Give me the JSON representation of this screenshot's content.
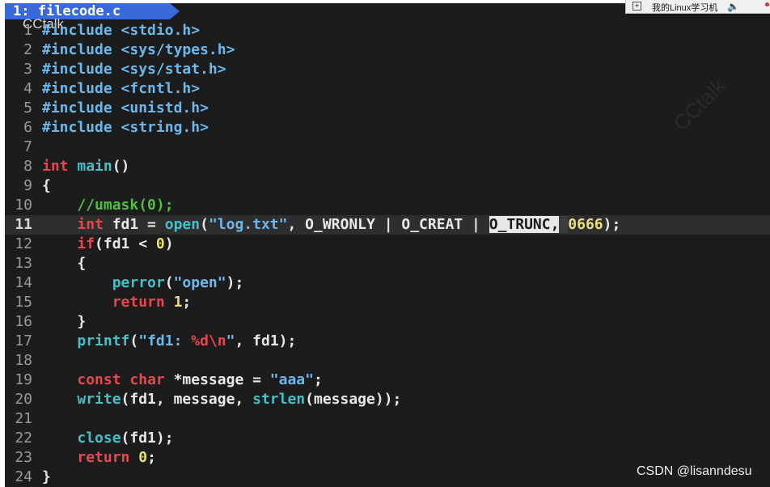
{
  "editor": {
    "tab_label": "1: filecode.c",
    "current_line": 11,
    "lines": [
      {
        "n": "1",
        "tokens": [
          {
            "t": "#include ",
            "c": "pre"
          },
          {
            "t": "<stdio.h>",
            "c": "pre"
          }
        ]
      },
      {
        "n": "2",
        "tokens": [
          {
            "t": "#include ",
            "c": "pre"
          },
          {
            "t": "<sys/types.h>",
            "c": "pre"
          }
        ]
      },
      {
        "n": "3",
        "tokens": [
          {
            "t": "#include ",
            "c": "pre"
          },
          {
            "t": "<sys/stat.h>",
            "c": "pre"
          }
        ]
      },
      {
        "n": "4",
        "tokens": [
          {
            "t": "#include ",
            "c": "pre"
          },
          {
            "t": "<fcntl.h>",
            "c": "pre"
          }
        ]
      },
      {
        "n": "5",
        "tokens": [
          {
            "t": "#include ",
            "c": "pre"
          },
          {
            "t": "<unistd.h>",
            "c": "pre"
          }
        ]
      },
      {
        "n": "6",
        "tokens": [
          {
            "t": "#include ",
            "c": "pre"
          },
          {
            "t": "<string.h>",
            "c": "pre"
          }
        ]
      },
      {
        "n": "7",
        "tokens": []
      },
      {
        "n": "8",
        "tokens": [
          {
            "t": "int",
            "c": "kw"
          },
          {
            "t": " ",
            "c": "plain"
          },
          {
            "t": "main",
            "c": "fn"
          },
          {
            "t": "()",
            "c": "plain"
          }
        ]
      },
      {
        "n": "9",
        "tokens": [
          {
            "t": "{",
            "c": "plain"
          }
        ]
      },
      {
        "n": "10",
        "tokens": [
          {
            "t": "    ",
            "c": "plain"
          },
          {
            "t": "//umask(0);",
            "c": "cmt"
          }
        ]
      },
      {
        "n": "11",
        "tokens": [
          {
            "t": "    ",
            "c": "plain"
          },
          {
            "t": "int",
            "c": "kw"
          },
          {
            "t": " fd1 = ",
            "c": "plain"
          },
          {
            "t": "open",
            "c": "fn"
          },
          {
            "t": "(",
            "c": "plain"
          },
          {
            "t": "\"log.txt\"",
            "c": "str"
          },
          {
            "t": ", O_WRONLY | O_CREAT | ",
            "c": "plain"
          },
          {
            "t": "O_TRUNC,",
            "c": "sel"
          },
          {
            "t": " ",
            "c": "cursor"
          },
          {
            "t": "0666",
            "c": "num"
          },
          {
            "t": ");",
            "c": "plain"
          }
        ]
      },
      {
        "n": "12",
        "tokens": [
          {
            "t": "    ",
            "c": "plain"
          },
          {
            "t": "if",
            "c": "kw"
          },
          {
            "t": "(fd1 < ",
            "c": "plain"
          },
          {
            "t": "0",
            "c": "num"
          },
          {
            "t": ")",
            "c": "plain"
          }
        ]
      },
      {
        "n": "13",
        "tokens": [
          {
            "t": "    {",
            "c": "plain"
          }
        ]
      },
      {
        "n": "14",
        "tokens": [
          {
            "t": "        ",
            "c": "plain"
          },
          {
            "t": "perror",
            "c": "fn"
          },
          {
            "t": "(",
            "c": "plain"
          },
          {
            "t": "\"open\"",
            "c": "str"
          },
          {
            "t": ");",
            "c": "plain"
          }
        ]
      },
      {
        "n": "15",
        "tokens": [
          {
            "t": "        ",
            "c": "plain"
          },
          {
            "t": "return",
            "c": "kw"
          },
          {
            "t": " ",
            "c": "plain"
          },
          {
            "t": "1",
            "c": "num"
          },
          {
            "t": ";",
            "c": "plain"
          }
        ]
      },
      {
        "n": "16",
        "tokens": [
          {
            "t": "    }",
            "c": "plain"
          }
        ]
      },
      {
        "n": "17",
        "tokens": [
          {
            "t": "    ",
            "c": "plain"
          },
          {
            "t": "printf",
            "c": "fn"
          },
          {
            "t": "(",
            "c": "plain"
          },
          {
            "t": "\"fd1: ",
            "c": "str"
          },
          {
            "t": "%d",
            "c": "kw"
          },
          {
            "t": "\\n",
            "c": "kw"
          },
          {
            "t": "\"",
            "c": "str"
          },
          {
            "t": ", fd1);",
            "c": "plain"
          }
        ]
      },
      {
        "n": "18",
        "tokens": []
      },
      {
        "n": "19",
        "tokens": [
          {
            "t": "    ",
            "c": "plain"
          },
          {
            "t": "const",
            "c": "kw"
          },
          {
            "t": " ",
            "c": "plain"
          },
          {
            "t": "char",
            "c": "kw"
          },
          {
            "t": " *message = ",
            "c": "plain"
          },
          {
            "t": "\"aaa\"",
            "c": "str"
          },
          {
            "t": ";",
            "c": "plain"
          }
        ]
      },
      {
        "n": "20",
        "tokens": [
          {
            "t": "    ",
            "c": "plain"
          },
          {
            "t": "write",
            "c": "fn"
          },
          {
            "t": "(fd1, message, ",
            "c": "plain"
          },
          {
            "t": "strlen",
            "c": "fn"
          },
          {
            "t": "(message));",
            "c": "plain"
          }
        ]
      },
      {
        "n": "21",
        "tokens": []
      },
      {
        "n": "22",
        "tokens": [
          {
            "t": "    ",
            "c": "plain"
          },
          {
            "t": "close",
            "c": "fn"
          },
          {
            "t": "(fd1);",
            "c": "plain"
          }
        ]
      },
      {
        "n": "23",
        "tokens": [
          {
            "t": "    ",
            "c": "plain"
          },
          {
            "t": "return",
            "c": "kw"
          },
          {
            "t": " ",
            "c": "plain"
          },
          {
            "t": "0",
            "c": "num"
          },
          {
            "t": ";",
            "c": "plain"
          }
        ]
      },
      {
        "n": "24",
        "tokens": [
          {
            "t": "}",
            "c": "plain"
          }
        ]
      }
    ]
  },
  "overlay": {
    "cctalk": "CCtalk"
  },
  "taskbar": {
    "title": "我的Linux学习机",
    "icon_glyph": "+",
    "speaker_glyph": "🔈"
  },
  "watermark": {
    "text": "CSDN @lisanndesu",
    "faint_diag": "CCtalk"
  },
  "colors": {
    "background": "#1c1c1c",
    "keyword": "#e5484d",
    "function": "#43c0c8",
    "string": "#6ab8ee",
    "number": "#e8e07a",
    "comment": "#4ec03b",
    "tab": "#3a6ad9"
  }
}
